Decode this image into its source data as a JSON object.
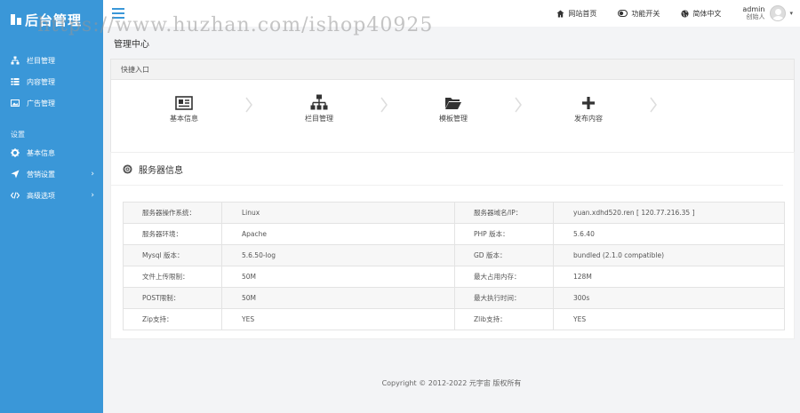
{
  "brand": {
    "logo_text": "后台管理"
  },
  "sidebar": {
    "items": [
      {
        "label": "栏目管理",
        "icon": "sitemap-icon"
      },
      {
        "label": "内容管理",
        "icon": "list-icon"
      },
      {
        "label": "广告管理",
        "icon": "image-icon"
      }
    ],
    "section_label": "设置",
    "settings_items": [
      {
        "label": "基本信息",
        "icon": "gear-icon",
        "has_caret": false
      },
      {
        "label": "营销设置",
        "icon": "send-icon",
        "caret": "›"
      },
      {
        "label": "高级选项",
        "icon": "code-icon",
        "caret": "›"
      }
    ]
  },
  "topbar": {
    "home_label": "网站首页",
    "toggle_label": "功能开关",
    "lang_label": "简体中文",
    "user_name": "admin",
    "user_role": "创始人",
    "user_caret": "▾"
  },
  "page": {
    "title": "管理中心"
  },
  "quick": {
    "header": "快捷入口",
    "items": [
      {
        "label": "基本信息",
        "icon": "id-card-icon"
      },
      {
        "label": "栏目管理",
        "icon": "sitemap-icon"
      },
      {
        "label": "模板管理",
        "icon": "folder-open-icon"
      },
      {
        "label": "发布内容",
        "icon": "plus-icon"
      }
    ]
  },
  "server": {
    "header": "服务器信息",
    "rows": [
      [
        "服务器操作系统：",
        "Linux",
        "服务器域名/IP：",
        "yuan.xdhd520.ren [ 120.77.216.35 ]"
      ],
      [
        "服务器环境：",
        "Apache",
        "PHP 版本：",
        "5.6.40"
      ],
      [
        "Mysql 版本：",
        "5.6.50-log",
        "GD 版本：",
        "bundled (2.1.0 compatible)"
      ],
      [
        "文件上传限制：",
        "50M",
        "最大占用内存：",
        "128M"
      ],
      [
        "POST限制：",
        "50M",
        "最大执行时间：",
        "300s"
      ],
      [
        "Zip支持：",
        "YES",
        "Zlib支持：",
        "YES"
      ]
    ]
  },
  "footer": {
    "copyright": "Copyright © 2012-2022 元宇宙 版权所有"
  },
  "watermark": {
    "text": "https://www.huzhan.com/ishop40925"
  },
  "colors": {
    "sidebar": "#3a97d8",
    "accent": "#3a97d8"
  }
}
